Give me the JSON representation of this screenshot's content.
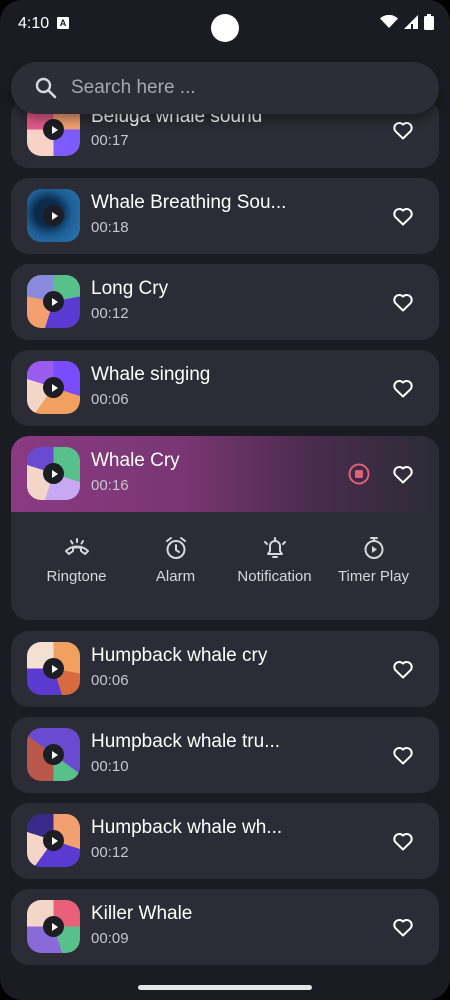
{
  "status": {
    "time": "4:10",
    "badge": "A"
  },
  "search": {
    "placeholder": "Search here ..."
  },
  "items": [
    {
      "title": "Beluga whale sound",
      "duration": "00:17"
    },
    {
      "title": "Whale Breathing Sou...",
      "duration": "00:18"
    },
    {
      "title": "Long Cry",
      "duration": "00:12"
    },
    {
      "title": "Whale singing",
      "duration": "00:06"
    },
    {
      "title": "Whale Cry",
      "duration": "00:16"
    },
    {
      "title": "Humpback whale cry",
      "duration": "00:06"
    },
    {
      "title": "Humpback whale tru...",
      "duration": "00:10"
    },
    {
      "title": "Humpback whale wh...",
      "duration": "00:12"
    },
    {
      "title": "Killer Whale",
      "duration": "00:09"
    }
  ],
  "actions": {
    "ringtone": "Ringtone",
    "alarm": "Alarm",
    "notification": "Notification",
    "timer": "Timer Play"
  },
  "icons": {
    "favorite": "heart-outline-icon",
    "stop": "stop-circle-icon",
    "search": "search-icon"
  },
  "colors": {
    "background": "#1b1c23",
    "card": "#2b2c35",
    "active_gradient_start": "#8a3a82",
    "stop_accent": "#e0607a"
  }
}
